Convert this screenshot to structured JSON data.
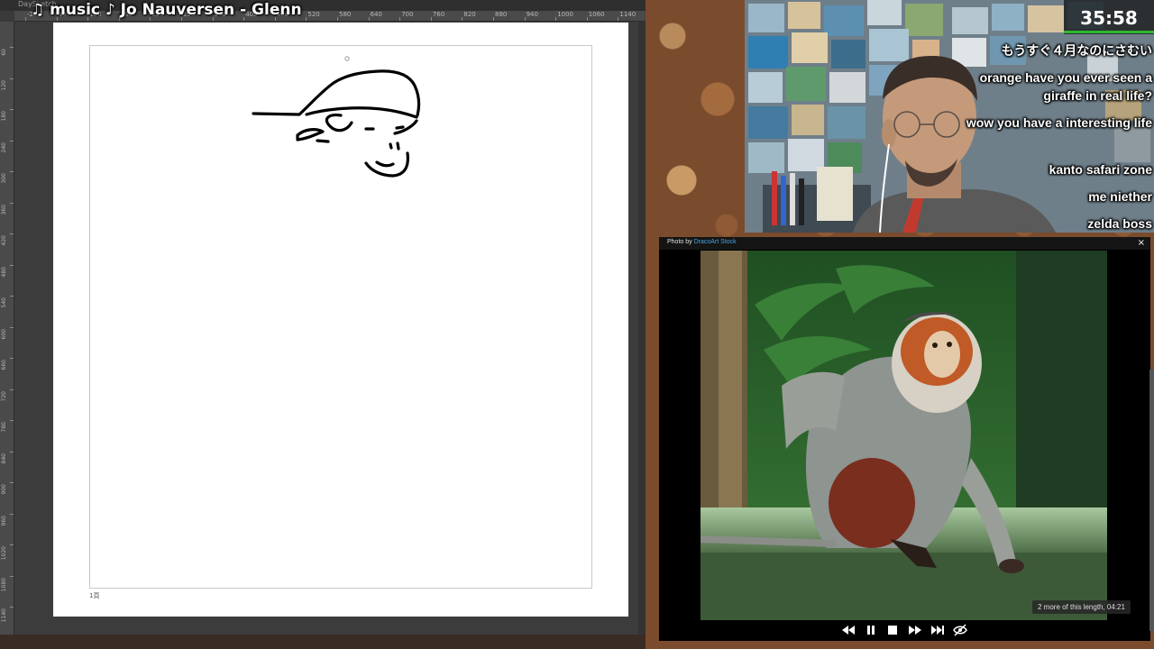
{
  "drawing_app": {
    "title": "DaySketch",
    "page_footer": "1頁",
    "ruler_top_labels": [
      "-20",
      "40",
      "100",
      "160",
      "220",
      "280",
      "340",
      "400",
      "460",
      "520",
      "580",
      "640",
      "700",
      "760",
      "820",
      "880",
      "940",
      "1000",
      "1060",
      "1140"
    ],
    "ruler_left_labels": [
      "60",
      "120",
      "180",
      "240",
      "300",
      "360",
      "420",
      "480",
      "540",
      "600",
      "660",
      "720",
      "780",
      "840",
      "900",
      "960",
      "1020",
      "1080",
      "1140"
    ]
  },
  "music": {
    "text": "♫ music ♪ Jo Nauversen - Glenn"
  },
  "stream": {
    "timer": "35:58",
    "chat_messages": [
      "もうすぐ４月なのにさむい",
      "orange have you ever seen a",
      "giraffe in real life?",
      "wow you have a interesting life",
      "kanto safari zone",
      "me niether",
      "zelda boss"
    ]
  },
  "photo_viewer": {
    "credit_prefix": "Photo by",
    "credit_author": "DracoArt Stock",
    "close_label": "×",
    "info_text": "2 more of this length, 04:21",
    "controls": [
      "rewind-icon",
      "pause-icon",
      "stop-icon",
      "fast-forward-icon",
      "skip-end-icon",
      "hide-icon"
    ]
  },
  "colors": {
    "canvas_bg": "#3c3c3c",
    "page": "#ffffff",
    "timer_bar": "#2eb82e",
    "credit_link": "#4aa3df",
    "foliage": "#2f6b2c"
  }
}
